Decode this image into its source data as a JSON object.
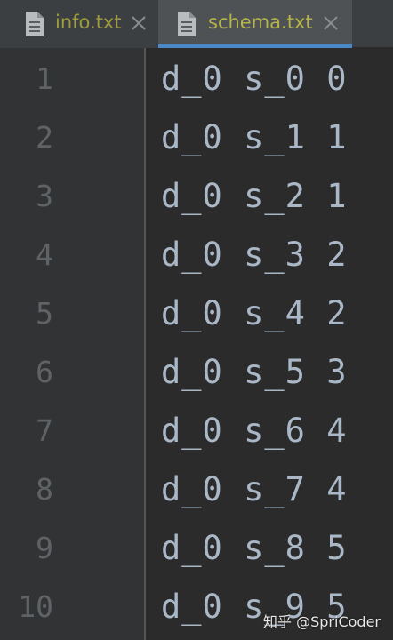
{
  "tabs": [
    {
      "label": "info.txt",
      "active": false
    },
    {
      "label": "schema.txt",
      "active": true
    }
  ],
  "editor": {
    "line_numbers": [
      "1",
      "2",
      "3",
      "4",
      "5",
      "6",
      "7",
      "8",
      "9",
      "10"
    ],
    "lines": [
      "d_0 s_0 0",
      "d_0 s_1 1",
      "d_0 s_2 1",
      "d_0 s_3 2",
      "d_0 s_4 2",
      "d_0 s_5 3",
      "d_0 s_6 4",
      "d_0 s_7 4",
      "d_0 s_8 5",
      "d_0 s_9 5"
    ]
  },
  "watermark": "知乎 @SpriCoder",
  "colors": {
    "tab_label": "#b4b448",
    "active_tab_underline": "#4a88c7",
    "code_text": "#a9b7c6",
    "line_number": "#606366",
    "editor_bg": "#2b2b2b"
  },
  "icons": {
    "file": "text-file-icon",
    "close": "close-icon"
  }
}
